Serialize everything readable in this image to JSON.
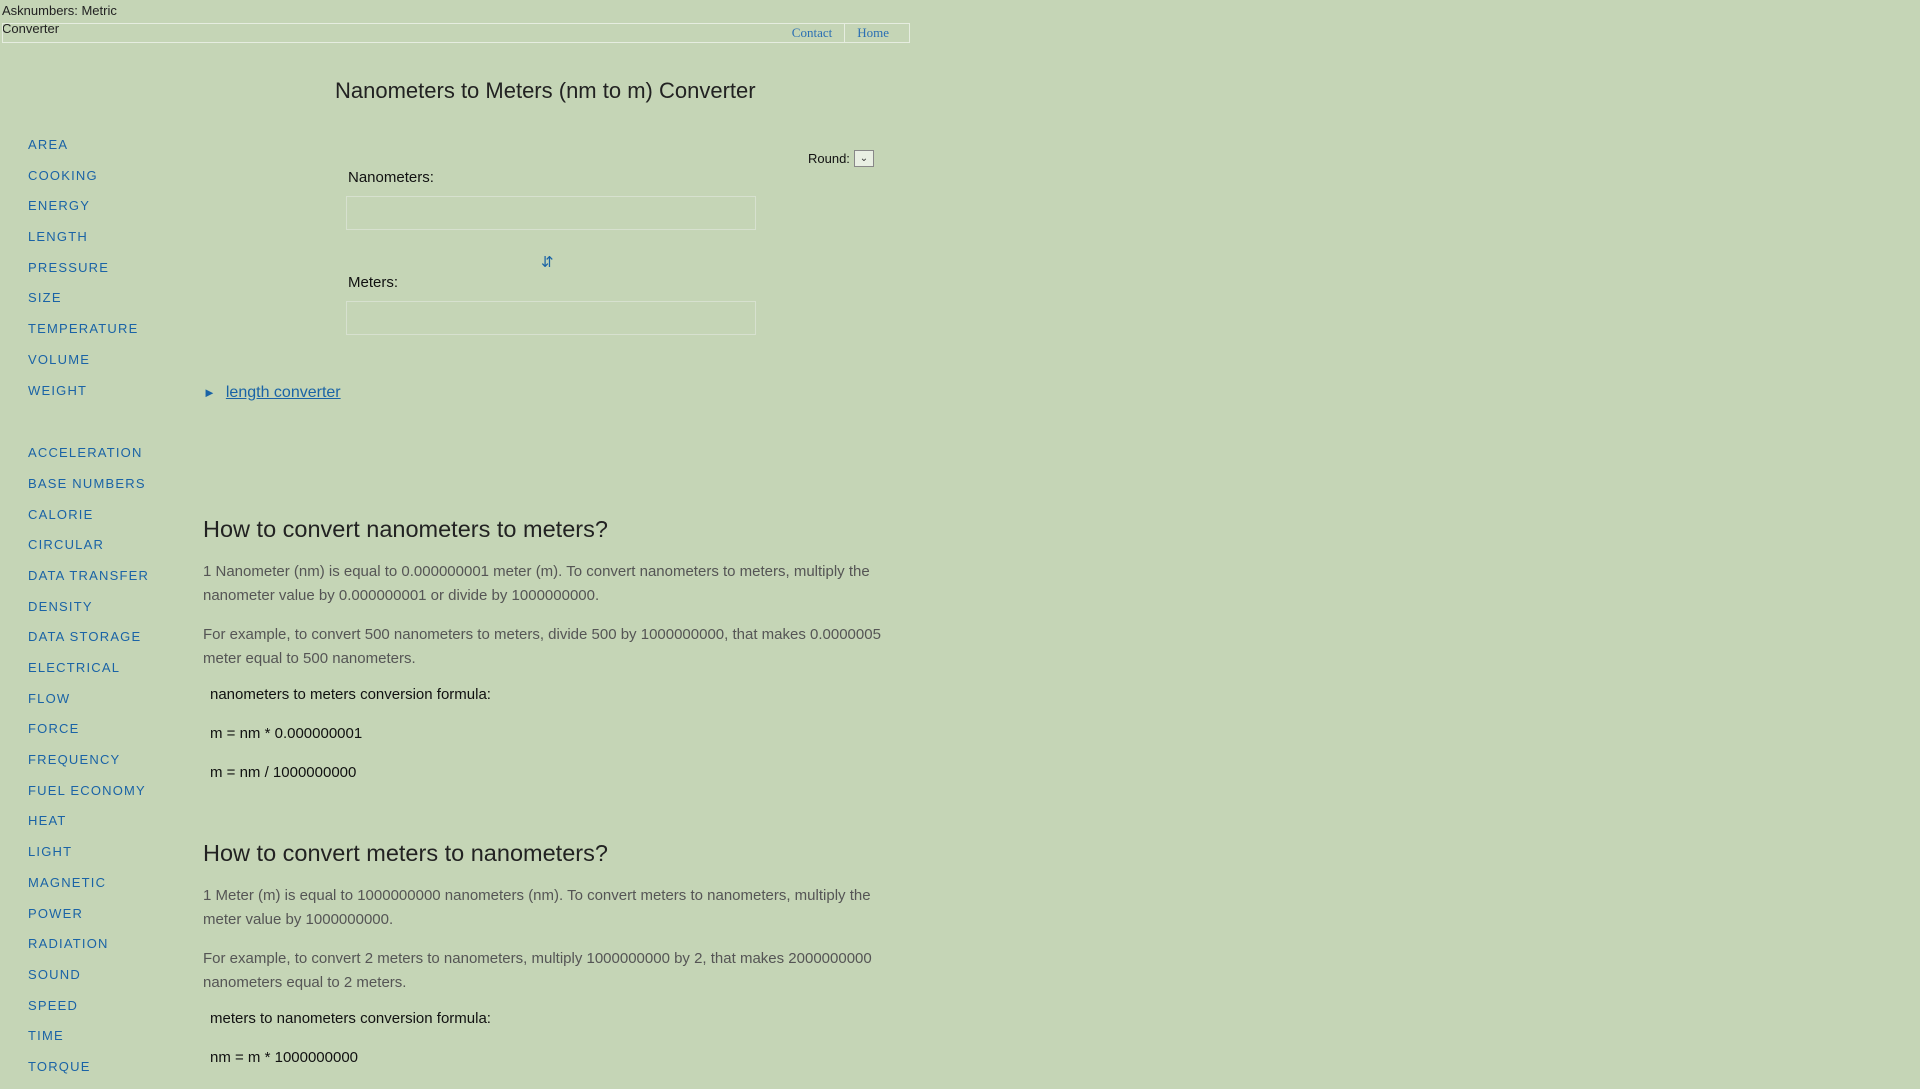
{
  "header": {
    "logo_alt": "Asknumbers: Metric Converter",
    "nav": [
      "Contact",
      "Home"
    ]
  },
  "page_title": "Nanometers to Meters (nm to m) Converter",
  "sidebar": {
    "group1": [
      "AREA",
      "COOKING",
      "ENERGY",
      "LENGTH",
      "PRESSURE",
      "SIZE",
      "TEMPERATURE",
      "VOLUME",
      "WEIGHT"
    ],
    "group2": [
      "ACCELERATION",
      "BASE NUMBERS",
      "CALORIE",
      "CIRCULAR",
      "DATA TRANSFER",
      "DENSITY",
      "DATA STORAGE",
      "ELECTRICAL",
      "FLOW",
      "FORCE",
      "FREQUENCY",
      "FUEL ECONOMY",
      "HEAT",
      "LIGHT",
      "MAGNETIC",
      "POWER",
      "RADIATION",
      "SOUND",
      "SPEED",
      "TIME",
      "TORQUE"
    ]
  },
  "converter": {
    "round_label": "Round:",
    "round_icon": "chevron-down-icon",
    "from_label": "Nanometers:",
    "from_value": "",
    "to_label": "Meters:",
    "to_value": "",
    "swap_glyph": "⇵",
    "swap_icon": "swap-arrows-icon"
  },
  "related_link": {
    "arrow": "►",
    "label": "length converter"
  },
  "sections": {
    "nm_to_m": {
      "heading": "How to convert nanometers to meters?",
      "p1": "1 Nanometer (nm) is equal to 0.000000001 meter (m). To convert nanometers to meters, multiply the nanometer value by 0.000000001 or divide by 1000000000.",
      "p2": "For example, to convert 500 nanometers to meters, divide 500 by 1000000000, that makes 0.0000005 meter equal to 500 nanometers.",
      "formula_title": "nanometers to meters conversion formula:",
      "formula1": "m = nm * 0.000000001",
      "formula2": "m = nm / 1000000000"
    },
    "m_to_nm": {
      "heading": "How to convert meters to nanometers?",
      "p1": "1 Meter (m) is equal to 1000000000 nanometers (nm). To convert meters to nanometers, multiply the meter value by 1000000000.",
      "p2": "For example, to convert 2 meters to nanometers, multiply 1000000000 by 2, that makes 2000000000 nanometers equal to 2 meters.",
      "formula_title": "meters to nanometers conversion formula:",
      "formula1": "nm = m * 1000000000"
    }
  }
}
